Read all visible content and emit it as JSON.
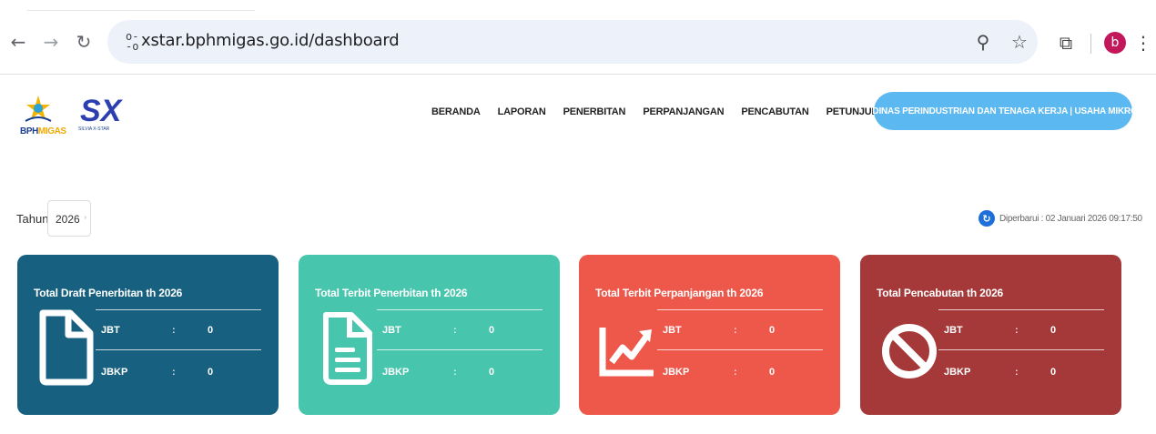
{
  "browser": {
    "url": "xstar.bphmigas.go.id/dashboard",
    "avatar_letter": "b"
  },
  "header": {
    "logo_bph_prefix": "BPH",
    "logo_bph_suffix": "MIGAS",
    "logo_sx": "SX",
    "logo_sx_sub": "SILVIA X-STAR",
    "nav": [
      "BERANDA",
      "LAPORAN",
      "PENERBITAN",
      "PERPANJANGAN",
      "PENCABUTAN",
      "PETUNJUK PENGGUNAAN"
    ],
    "user_button": "DINAS PERINDUSTRIAN DAN TENAGA KERJA | USAHA MIKRO"
  },
  "filter": {
    "label": "Tahun",
    "year": "2026"
  },
  "updated": {
    "text": "Diperbarui : 02 Januari 2026 09:17:50"
  },
  "cards": [
    {
      "title": "Total Draft Penerbitan th 2026",
      "icon": "document-icon",
      "color": "#17607f",
      "rows": [
        {
          "label": "JBT",
          "sep": ":",
          "value": "0"
        },
        {
          "label": "JBKP",
          "sep": ":",
          "value": "0"
        }
      ]
    },
    {
      "title": "Total Terbit Penerbitan th 2026",
      "icon": "document-text-icon",
      "color": "#48c5ad",
      "rows": [
        {
          "label": "JBT",
          "sep": ":",
          "value": "0"
        },
        {
          "label": "JBKP",
          "sep": ":",
          "value": "0"
        }
      ]
    },
    {
      "title": "Total Terbit Perpanjangan th 2026",
      "icon": "trend-chart-icon",
      "color": "#ee584b",
      "rows": [
        {
          "label": "JBT",
          "sep": ":",
          "value": "0"
        },
        {
          "label": "JBKP",
          "sep": ":",
          "value": "0"
        }
      ]
    },
    {
      "title": "Total Pencabutan th 2026",
      "icon": "ban-icon",
      "color": "#a53838",
      "rows": [
        {
          "label": "JBT",
          "sep": ":",
          "value": "0"
        },
        {
          "label": "JBKP",
          "sep": ":",
          "value": "0"
        }
      ]
    }
  ]
}
